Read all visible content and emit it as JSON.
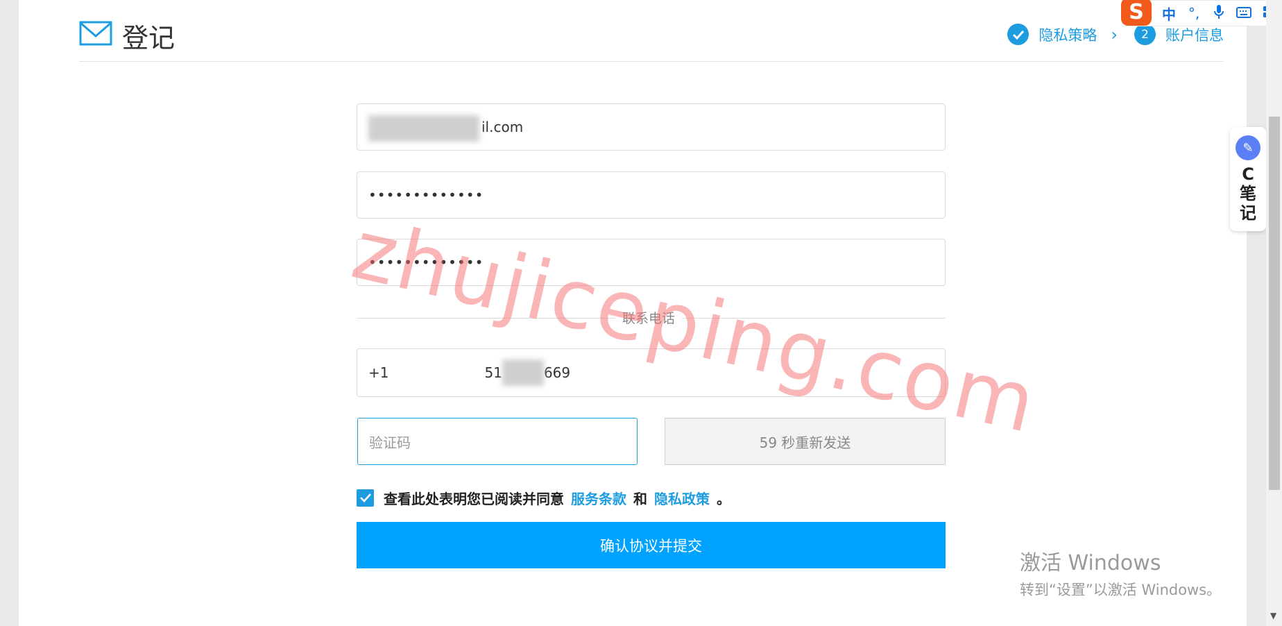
{
  "header": {
    "title": "登记",
    "steps": [
      {
        "label": "隐私策略",
        "state": "done"
      },
      {
        "number": "2",
        "label": "账户信息",
        "state": "current"
      }
    ]
  },
  "form": {
    "email_value": "il.com",
    "password_value": "•••••••••••••",
    "confirm_password_value": "•••••••••••••",
    "phone_section_label": "联系电话",
    "country_code": "+1",
    "phone_prefix": "51",
    "phone_suffix": "669",
    "code_placeholder": "验证码",
    "resend_label": "59 秒重新发送",
    "agree_text": "查看此处表明您已阅读并同意",
    "terms_link": "服务条款",
    "and_text": "和",
    "privacy_link": "隐私政策",
    "period": "。",
    "submit_label": "确认协议并提交"
  },
  "watermark": "zhujiceping.com",
  "windows_activation": {
    "title": "激活 Windows",
    "subtitle": "转到“设置”以激活 Windows。"
  },
  "ime": {
    "logo": "S",
    "mode": "中",
    "punct": "°,"
  },
  "side_widget": {
    "text": "C笔记"
  },
  "colors": {
    "accent": "#1e9ce0",
    "submit": "#00a2ff",
    "watermark": "#f56e6e"
  }
}
